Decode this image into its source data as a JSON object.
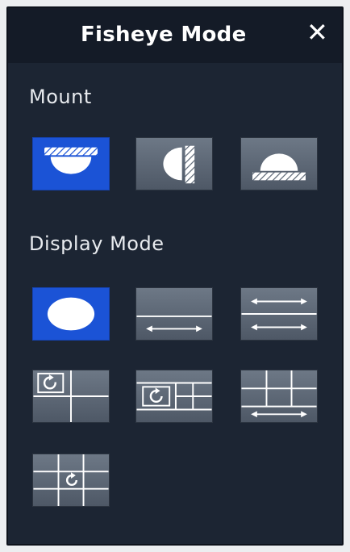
{
  "dialog": {
    "title": "Fisheye Mode",
    "close_label": "✕"
  },
  "mount": {
    "label": "Mount",
    "options": [
      {
        "name": "ceiling-mount",
        "selected": true
      },
      {
        "name": "wall-mount",
        "selected": false
      },
      {
        "name": "desktop-mount",
        "selected": false
      }
    ]
  },
  "display_mode": {
    "label": "Display Mode",
    "options": [
      {
        "name": "original-fisheye",
        "selected": true
      },
      {
        "name": "panorama",
        "selected": false
      },
      {
        "name": "dual-panorama",
        "selected": false
      },
      {
        "name": "fisheye-plus-3ptz",
        "selected": false
      },
      {
        "name": "fisheye-plus-8ptz",
        "selected": false
      },
      {
        "name": "panorama-plus-6ptz",
        "selected": false
      },
      {
        "name": "fisheye-plus-8ptz-grid",
        "selected": false
      }
    ]
  },
  "colors": {
    "panel_bg": "#1c2533",
    "header_bg": "#141b27",
    "selected_accent": "#1b53d6",
    "button_bg": "#5d6876"
  }
}
